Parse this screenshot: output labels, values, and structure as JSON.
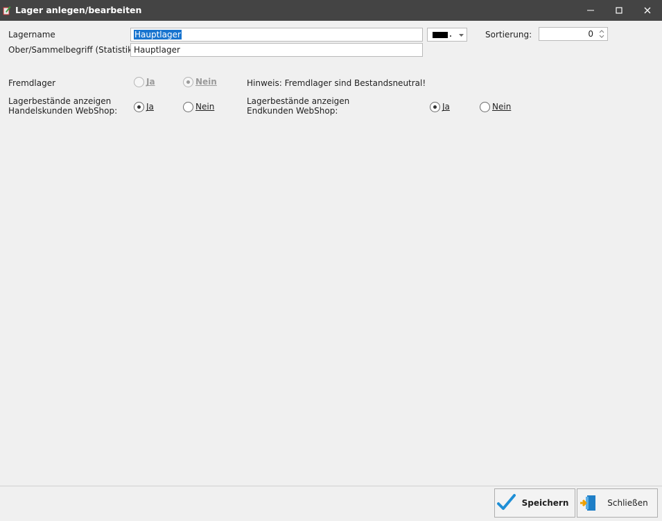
{
  "window": {
    "title": "Lager anlegen/bearbeiten"
  },
  "form": {
    "lagername": {
      "label": "Lagername",
      "value": "Hauptlager"
    },
    "obergriff": {
      "label": "Ober/Sammelbegriff (Statistik)",
      "value": "Hauptlager"
    },
    "farbe": {
      "color": "#000000"
    },
    "sortierung": {
      "label": "Sortierung:",
      "value": "0"
    },
    "fremdlager": {
      "label": "Fremdlager",
      "ja": "Ja",
      "nein": "Nein",
      "selected": "Nein",
      "hint": "Hinweis: Fremdlager sind Bestandsneutral!"
    },
    "handelskunden": {
      "label": "Lagerbestände anzeigen\nHandelskunden WebShop:",
      "ja": "Ja",
      "nein": "Nein",
      "selected": "Ja"
    },
    "endkunden": {
      "label": "Lagerbestände anzeigen\nEndkunden WebShop:",
      "ja": "Ja",
      "nein": "Nein",
      "selected": "Ja"
    }
  },
  "buttons": {
    "save": "Speichern",
    "close": "Schließen"
  }
}
